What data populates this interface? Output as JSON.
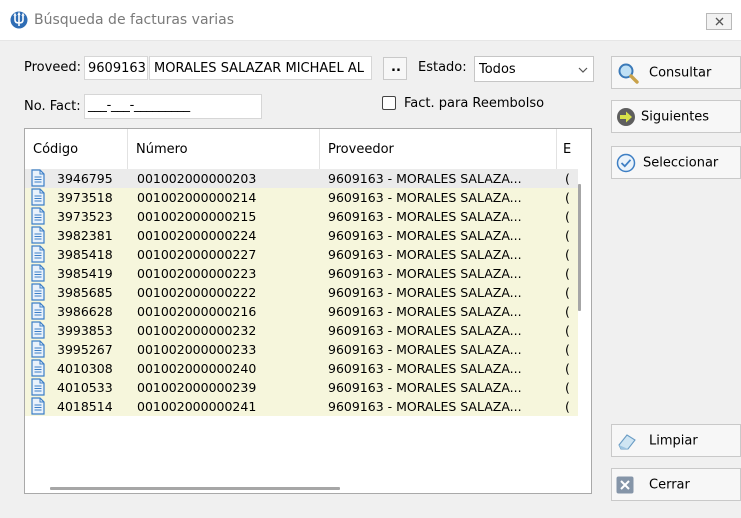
{
  "window": {
    "title": "Búsqueda de facturas varias"
  },
  "filters": {
    "proveedor_label": "Proveed:",
    "proveedor_code": "9609163",
    "proveedor_name": "MORALES SALAZAR MICHAEL AL",
    "lookup_label": "..",
    "estado_label": "Estado:",
    "estado_value": "Todos",
    "nofact_label": "No. Fact:",
    "nofact_mask": "___-___-_________",
    "reembolso_label": "Fact. para Reembolso",
    "reembolso_checked": false
  },
  "buttons": {
    "consultar": "Consultar",
    "siguientes": "Siguientes",
    "seleccionar": "Seleccionar",
    "limpiar": "Limpiar",
    "cerrar": "Cerrar"
  },
  "table": {
    "columns": [
      "Código",
      "Número",
      "Proveedor",
      "E"
    ],
    "rows": [
      {
        "codigo": "3946795",
        "numero": "001002000000203",
        "proveedor": "9609163 - MORALES SALAZA...",
        "e": "(",
        "selected": true
      },
      {
        "codigo": "3973518",
        "numero": "001002000000214",
        "proveedor": "9609163 - MORALES SALAZA...",
        "e": "("
      },
      {
        "codigo": "3973523",
        "numero": "001002000000215",
        "proveedor": "9609163 - MORALES SALAZA...",
        "e": "("
      },
      {
        "codigo": "3982381",
        "numero": "001002000000224",
        "proveedor": "9609163 - MORALES SALAZA...",
        "e": "("
      },
      {
        "codigo": "3985418",
        "numero": "001002000000227",
        "proveedor": "9609163 - MORALES SALAZA...",
        "e": "("
      },
      {
        "codigo": "3985419",
        "numero": "001002000000223",
        "proveedor": "9609163 - MORALES SALAZA...",
        "e": "("
      },
      {
        "codigo": "3985685",
        "numero": "001002000000222",
        "proveedor": "9609163 - MORALES SALAZA...",
        "e": "("
      },
      {
        "codigo": "3986628",
        "numero": "001002000000216",
        "proveedor": "9609163 - MORALES SALAZA...",
        "e": "("
      },
      {
        "codigo": "3993853",
        "numero": "001002000000232",
        "proveedor": "9609163 - MORALES SALAZA...",
        "e": "("
      },
      {
        "codigo": "3995267",
        "numero": "001002000000233",
        "proveedor": "9609163 - MORALES SALAZA...",
        "e": "("
      },
      {
        "codigo": "4010308",
        "numero": "001002000000240",
        "proveedor": "9609163 - MORALES SALAZA...",
        "e": "("
      },
      {
        "codigo": "4010533",
        "numero": "001002000000239",
        "proveedor": "9609163 - MORALES SALAZA...",
        "e": "("
      },
      {
        "codigo": "4018514",
        "numero": "001002000000241",
        "proveedor": "9609163 - MORALES SALAZA...",
        "e": "("
      }
    ]
  },
  "colors": {
    "row_bg": "#f6f6dc",
    "selected_row_bg": "#ebebeb",
    "doc_icon": "#3d7fc7"
  },
  "icons": {
    "app": "trident-app-icon",
    "close": "close-x-icon",
    "consultar": "magnifier-icon",
    "siguientes": "arrow-right-circle-icon",
    "seleccionar": "check-circle-icon",
    "limpiar": "eraser-icon",
    "cerrar": "close-box-icon",
    "row": "document-icon"
  }
}
